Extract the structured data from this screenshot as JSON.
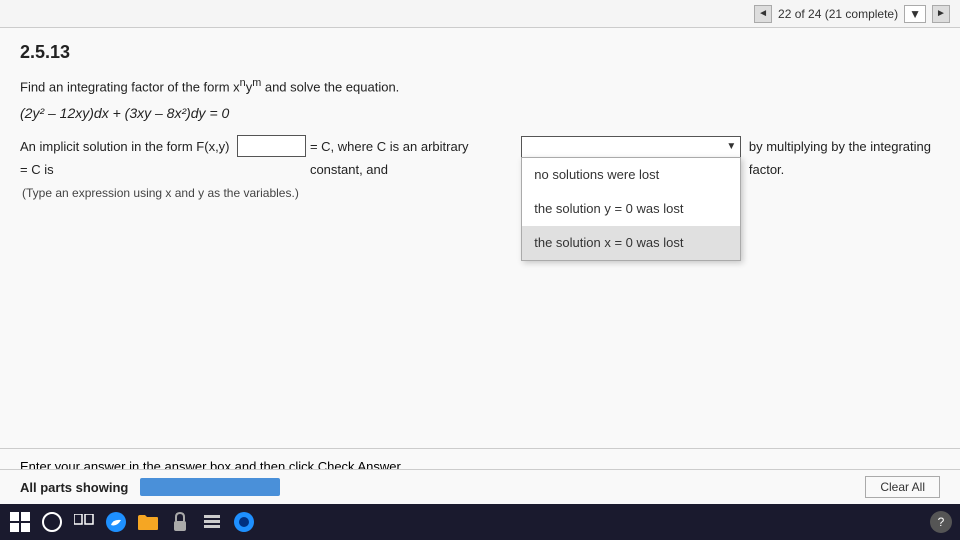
{
  "topbar": {
    "progress_text": "22 of 24 (21 complete)",
    "prev_icon": "◄",
    "next_icon": "►",
    "dropdown_arrow": "▼"
  },
  "problem": {
    "number": "2.5.13",
    "instruction": "Find an integrating factor of the form x",
    "instruction_super_n": "n",
    "instruction_mid": "y",
    "instruction_super_m": "m",
    "instruction_end": " and solve the equation.",
    "equation": "(2y² – 12xy)dx + (3xy – 8x²)dy = 0",
    "answer_prefix": "An implicit solution in the form F(x,y) = C is",
    "answer_mid": "= C, where C is an arbitrary constant, and",
    "multiply_text": "by multiplying by the integrating factor.",
    "type_hint": "(Type an expression using x and y as the variables.)"
  },
  "dropdown": {
    "placeholder": "",
    "options": [
      "no solutions were lost",
      "the solution y = 0 was lost",
      "the solution x = 0 was lost"
    ],
    "highlighted_index": 2
  },
  "footer": {
    "enter_text": "Enter your answer in the answer box and then click Check Answer.",
    "all_parts_label": "All parts showing",
    "clear_all_label": "Clear All"
  },
  "taskbar": {
    "help_label": "?"
  }
}
